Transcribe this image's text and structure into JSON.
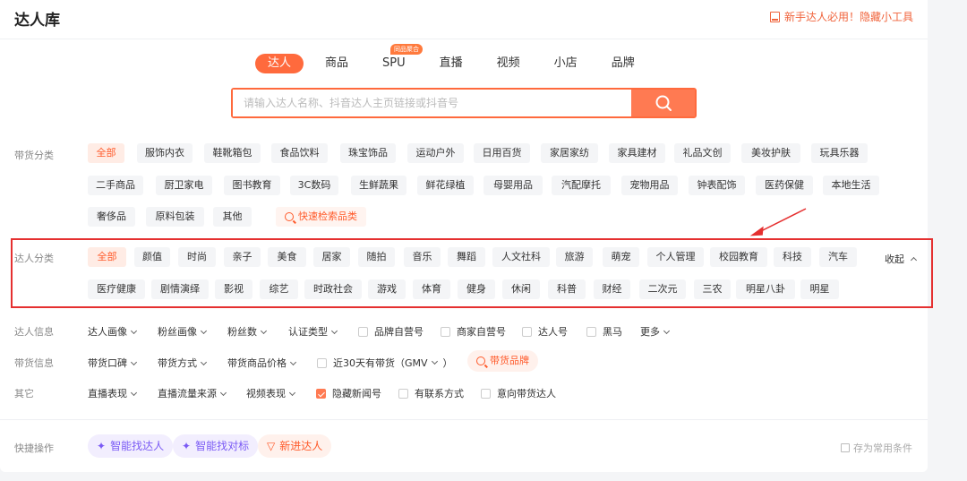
{
  "header": {
    "title": "达人库",
    "tool_link": "新手达人必用！隐藏小工具"
  },
  "tabs": [
    {
      "label": "达人",
      "active": true
    },
    {
      "label": "商品"
    },
    {
      "label": "SPU",
      "badge": "同品聚合"
    },
    {
      "label": "直播"
    },
    {
      "label": "视频"
    },
    {
      "label": "小店"
    },
    {
      "label": "品牌"
    }
  ],
  "search": {
    "placeholder": "请输入达人名称、抖音达人主页链接或抖音号",
    "button_icon": "search-icon"
  },
  "goods_category": {
    "label": "带货分类",
    "items": [
      "全部",
      "服饰内衣",
      "鞋靴箱包",
      "食品饮料",
      "珠宝饰品",
      "运动户外",
      "日用百货",
      "家居家纺",
      "家具建材",
      "礼品文创",
      "美妆护肤",
      "玩具乐器",
      "二手商品",
      "厨卫家电",
      "图书教育",
      "3C数码",
      "生鲜蔬果",
      "鲜花绿植",
      "母婴用品",
      "汽配摩托",
      "宠物用品",
      "钟表配饰",
      "医药保健",
      "本地生活",
      "奢侈品",
      "原料包装",
      "其他"
    ],
    "quick_search": "快速检索品类"
  },
  "influencer_category": {
    "label": "达人分类",
    "items": [
      "全部",
      "颜值",
      "时尚",
      "亲子",
      "美食",
      "居家",
      "随拍",
      "音乐",
      "舞蹈",
      "人文社科",
      "旅游",
      "萌宠",
      "个人管理",
      "校园教育",
      "科技",
      "汽车",
      "医疗健康",
      "剧情演绎",
      "影视",
      "综艺",
      "时政社会",
      "游戏",
      "体育",
      "健身",
      "休闲",
      "科普",
      "财经",
      "二次元",
      "三农",
      "明星八卦",
      "明星"
    ],
    "collapse": "收起"
  },
  "influencer_info": {
    "label": "达人信息",
    "dropdowns": [
      "达人画像",
      "粉丝画像",
      "粉丝数",
      "认证类型"
    ],
    "checkboxes": [
      "品牌自营号",
      "商家自营号",
      "达人号",
      "黑马"
    ],
    "more": "更多"
  },
  "goods_info": {
    "label": "带货信息",
    "dropdowns": [
      "带货口碑",
      "带货方式",
      "带货商品价格"
    ],
    "gmv_checkbox": "近30天有带货（GMV",
    "brand_button": "带货品牌"
  },
  "other": {
    "label": "其它",
    "dropdowns": [
      "直播表现",
      "直播流量来源",
      "视频表现"
    ],
    "checkboxes": [
      {
        "label": "隐藏新闻号",
        "checked": true
      },
      {
        "label": "有联系方式",
        "checked": false
      },
      {
        "label": "意向带货达人",
        "checked": false
      }
    ]
  },
  "shortcuts": {
    "label": "快捷操作",
    "buttons": [
      "智能找达人",
      "智能找对标",
      "新进达人"
    ],
    "save": "存为常用条件"
  },
  "colors": {
    "accent": "#ff6a3d",
    "highlight_box": "#e53030"
  }
}
